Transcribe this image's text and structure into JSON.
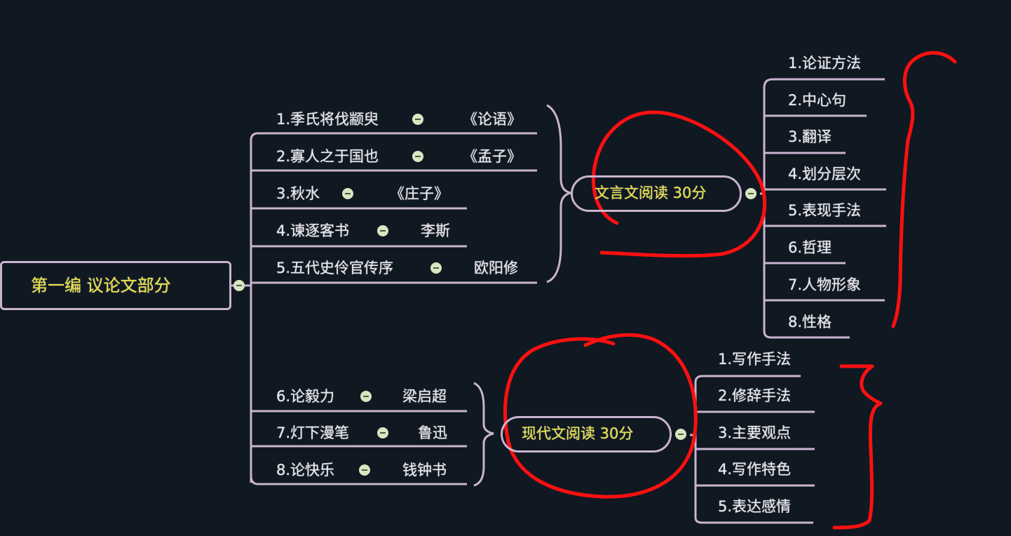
{
  "root": {
    "label": "第一编 议论文部分"
  },
  "branches": [
    {
      "label": "文言文阅读 30分",
      "texts": [
        {
          "title": "1.季氏将伐颛臾",
          "source": "《论语》"
        },
        {
          "title": "2.寡人之于国也",
          "source": "《孟子》"
        },
        {
          "title": "3.秋水",
          "source": "《庄子》"
        },
        {
          "title": "4.谏逐客书",
          "source": "李斯"
        },
        {
          "title": "5.五代史伶官传序",
          "source": "欧阳修"
        }
      ],
      "points": [
        "1.论证方法",
        "2.中心句",
        "3.翻译",
        "4.划分层次",
        "5.表现手法",
        "6.哲理",
        "7.人物形象",
        "8.性格"
      ]
    },
    {
      "label": "现代文阅读 30分",
      "texts": [
        {
          "title": "6.论毅力",
          "source": "梁启超"
        },
        {
          "title": "7.灯下漫笔",
          "source": "鲁迅"
        },
        {
          "title": "8.论快乐",
          "source": "钱钟书"
        }
      ],
      "points": [
        "1.写作手法",
        "2.修辞手法",
        "3.主要观点",
        "4.写作特色",
        "5.表达感情"
      ]
    }
  ],
  "colors": {
    "background": "#101822",
    "line": "#c9b4cf",
    "highlight_text": "#e8e040",
    "annotation": "#ff1010"
  }
}
